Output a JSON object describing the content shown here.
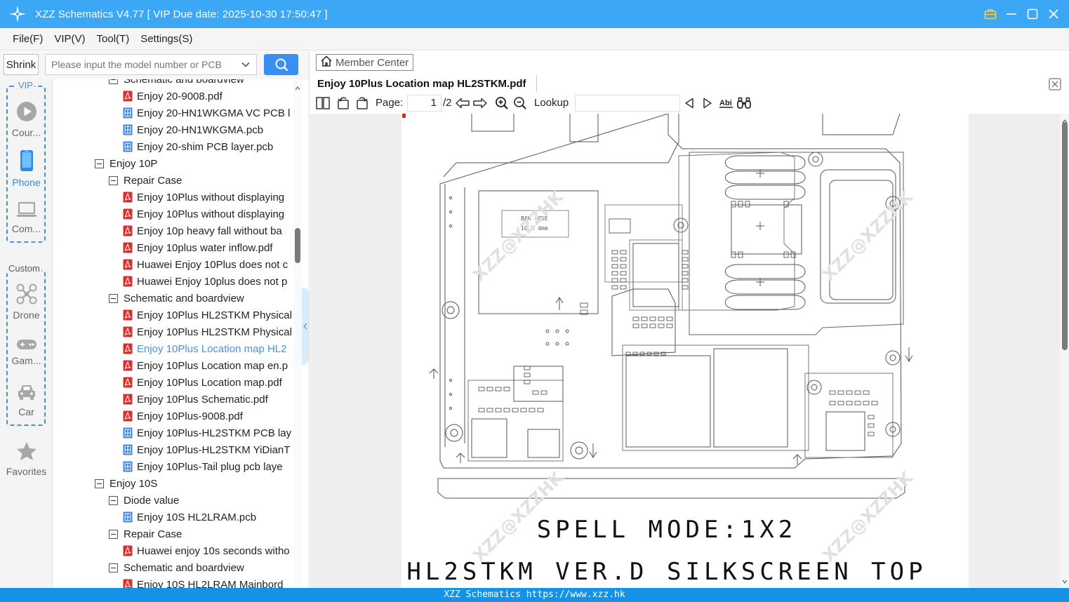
{
  "titlebar": {
    "title": "XZZ Schematics V4.77 [ VIP Due date: 2025-10-30 17:50:47 ]"
  },
  "menu": [
    "File(F)",
    "VIP(V)",
    "Tool(T)",
    "Settings(S)"
  ],
  "search": {
    "shrink_label": "Shrink",
    "placeholder": "Please input the model number or PCB"
  },
  "sidebar": {
    "vip_label": "VIP",
    "custom_label": "Custom",
    "items": [
      {
        "label": "Cour...",
        "icon": "play-icon"
      },
      {
        "label": "Phone",
        "icon": "phone-icon"
      },
      {
        "label": "Com...",
        "icon": "laptop-icon"
      },
      {
        "label": "Drone",
        "icon": "drone-icon"
      },
      {
        "label": "Gam...",
        "icon": "gamepad-icon"
      },
      {
        "label": "Car",
        "icon": "car-icon"
      },
      {
        "label": "Favorites",
        "icon": "star-icon"
      }
    ]
  },
  "tree": {
    "rows": [
      {
        "level": 2,
        "type": "folder",
        "label": "Schematic and boardview"
      },
      {
        "level": 3,
        "type": "pdf",
        "label": "Enjoy 20-9008.pdf"
      },
      {
        "level": 3,
        "type": "pcb",
        "label": "Enjoy 20-HN1WKGMA VC PCB l"
      },
      {
        "level": 3,
        "type": "pcb",
        "label": "Enjoy 20-HN1WKGMA.pcb"
      },
      {
        "level": 3,
        "type": "pcb",
        "label": "Enjoy 20-shim PCB layer.pcb"
      },
      {
        "level": 1,
        "type": "folder",
        "label": "Enjoy 10P"
      },
      {
        "level": 2,
        "type": "folder",
        "label": "Repair Case"
      },
      {
        "level": 3,
        "type": "pdf",
        "label": "Enjoy 10Plus without displaying"
      },
      {
        "level": 3,
        "type": "pdf",
        "label": "Enjoy 10Plus without displaying"
      },
      {
        "level": 3,
        "type": "pdf",
        "label": "Enjoy 10p heavy fall without ba"
      },
      {
        "level": 3,
        "type": "pdf",
        "label": "Enjoy 10plus water inflow.pdf"
      },
      {
        "level": 3,
        "type": "pdf",
        "label": "Huawei Enjoy 10Plus does not c"
      },
      {
        "level": 3,
        "type": "pdf",
        "label": "Huawei Enjoy 10plus does not p"
      },
      {
        "level": 2,
        "type": "folder",
        "label": "Schematic and boardview"
      },
      {
        "level": 3,
        "type": "pdf",
        "label": "Enjoy 10Plus HL2STKM Physical"
      },
      {
        "level": 3,
        "type": "pdf",
        "label": "Enjoy 10Plus HL2STKM Physical"
      },
      {
        "level": 3,
        "type": "pdf",
        "label": "Enjoy 10Plus Location map HL2",
        "selected": true
      },
      {
        "level": 3,
        "type": "pdf",
        "label": "Enjoy 10Plus Location map en.p"
      },
      {
        "level": 3,
        "type": "pdf",
        "label": "Enjoy 10Plus Location map.pdf"
      },
      {
        "level": 3,
        "type": "pdf",
        "label": "Enjoy 10Plus Schematic.pdf"
      },
      {
        "level": 3,
        "type": "pdf",
        "label": "Enjoy 10Plus-9008.pdf"
      },
      {
        "level": 3,
        "type": "pcb",
        "label": "Enjoy 10Plus-HL2STKM PCB lay"
      },
      {
        "level": 3,
        "type": "pcb",
        "label": "Enjoy 10Plus-HL2STKM YiDianT"
      },
      {
        "level": 3,
        "type": "pcb",
        "label": "Enjoy 10Plus-Tail plug pcb laye"
      },
      {
        "level": 1,
        "type": "folder",
        "label": "Enjoy 10S"
      },
      {
        "level": 2,
        "type": "folder",
        "label": "Diode value"
      },
      {
        "level": 3,
        "type": "pcb",
        "label": "Enjoy 10S HL2LRAM.pcb"
      },
      {
        "level": 2,
        "type": "folder",
        "label": "Repair Case"
      },
      {
        "level": 3,
        "type": "pdf",
        "label": "Huawei enjoy 10s seconds witho"
      },
      {
        "level": 2,
        "type": "folder",
        "label": "Schematic and boardview"
      },
      {
        "level": 3,
        "type": "pdf",
        "label": "Enjoy 10S HL2LRAM Mainbord"
      }
    ]
  },
  "viewer": {
    "member_center": "Member Center",
    "tab_title": "Enjoy 10Plus Location map HL2STKM.pdf",
    "page_label": "Page:",
    "page_current": "1",
    "page_total": "/2",
    "lookup_label": "Lookup",
    "lookup_value": "",
    "doc": {
      "barcode_title": "BAR CODE",
      "barcode_size": "10 X 4mm",
      "spell_mode": "SPELL MODE:1X2",
      "silkscreen": "HL2STKM VER.D SILKSCREEN TOP",
      "watermark": "XZZ@XZZHK"
    }
  },
  "statusbar": {
    "text": "XZZ Schematics https://www.xzz.hk"
  },
  "colors": {
    "titlebar": "#3ba7f5",
    "accent": "#3b8ff0",
    "statusbar": "#1493e6",
    "selected_text": "#4a90e8",
    "pdf_icon": "#d9302f",
    "pcb_icon": "#3c82d8"
  }
}
